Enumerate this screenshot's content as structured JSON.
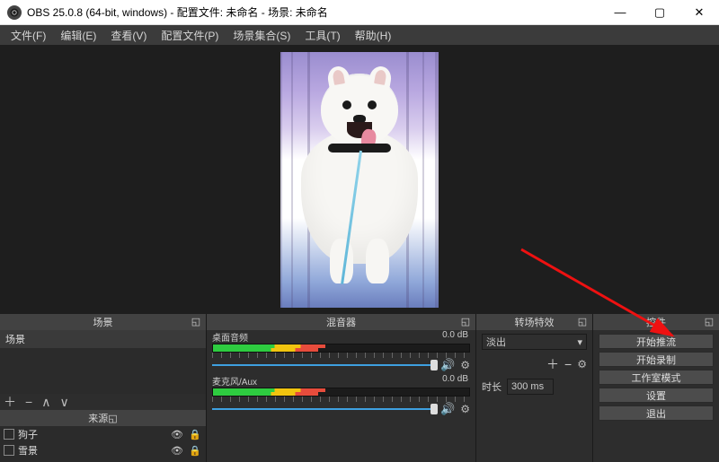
{
  "titlebar": {
    "text": "OBS 25.0.8 (64-bit, windows) - 配置文件: 未命名 - 场景: 未命名"
  },
  "menus": [
    "文件(F)",
    "编辑(E)",
    "查看(V)",
    "配置文件(P)",
    "场景集合(S)",
    "工具(T)",
    "帮助(H)"
  ],
  "panels": {
    "scenes": {
      "title": "场景",
      "items": [
        "场景"
      ],
      "sources_title": "来源",
      "sources": [
        {
          "name": "狗子",
          "visible": true,
          "locked": true
        },
        {
          "name": "雪景",
          "visible": true,
          "locked": true
        }
      ]
    },
    "mixer": {
      "title": "混音器",
      "channels": [
        {
          "name": "桌面音频",
          "db": "0.0 dB"
        },
        {
          "name": "麦克风/Aux",
          "db": "0.0 dB"
        }
      ]
    },
    "transitions": {
      "title": "转场特效",
      "mode": "淡出",
      "duration_label": "时长",
      "duration_value": "300 ms"
    },
    "controls": {
      "title": "控件",
      "buttons": [
        "开始推流",
        "开始录制",
        "工作室模式",
        "设置",
        "退出"
      ]
    }
  }
}
